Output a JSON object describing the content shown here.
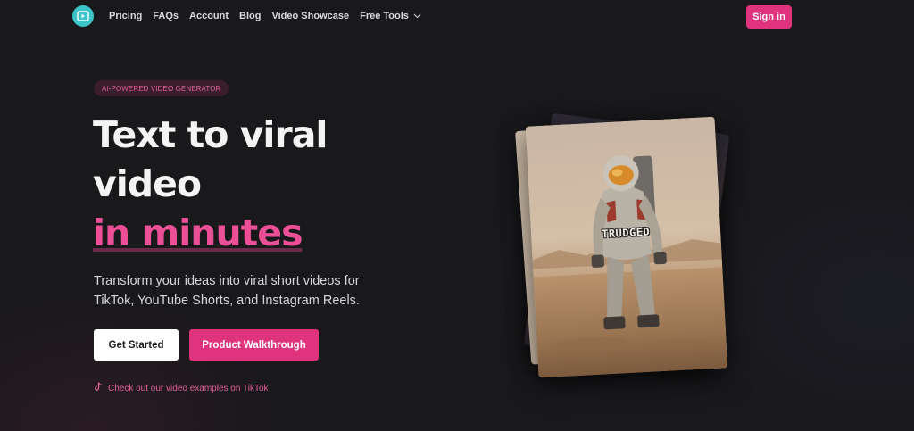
{
  "nav": {
    "links": [
      "Pricing",
      "FAQs",
      "Account",
      "Blog",
      "Video Showcase",
      "Free Tools"
    ],
    "signin_label": "Sign in"
  },
  "hero": {
    "badge": "AI-POWERED VIDEO GENERATOR",
    "headline_line1": "Text to viral",
    "headline_line2": "video",
    "headline_line3": "in minutes",
    "subtitle": "Transform your ideas into viral short videos for TikTok, YouTube Shorts, and Instagram Reels.",
    "primary_button": "Get Started",
    "secondary_button": "Product Walkthrough",
    "tiktok_link": "Check out our video examples on TikTok"
  },
  "preview": {
    "caption": "TRUDGED"
  },
  "colors": {
    "background": "#19181b",
    "accent": "#e0337d",
    "accent_text": "#ec4f96",
    "logo": "#3dc4c8"
  },
  "icons": [
    "play-logo-icon",
    "chevron-down-icon",
    "tiktok-icon"
  ]
}
